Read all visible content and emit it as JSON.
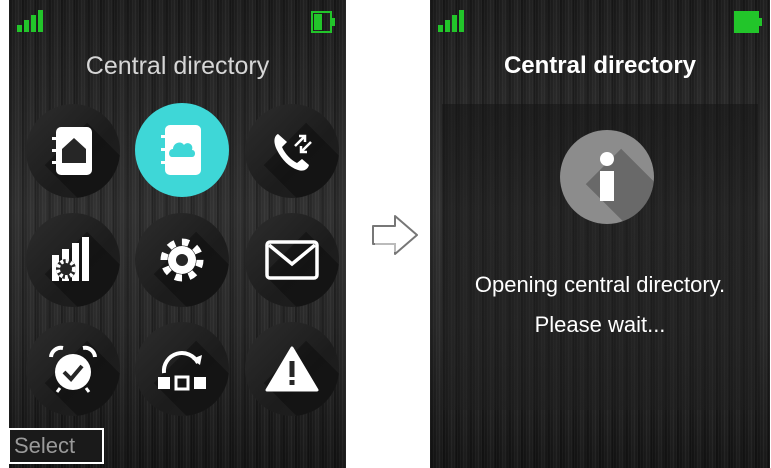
{
  "left_screen": {
    "status": {
      "signal_bars": 4,
      "battery_level": 0.5
    },
    "title": "Central directory",
    "menu_icons": [
      {
        "name": "local-phonebook-icon",
        "active": false
      },
      {
        "name": "central-directory-icon",
        "active": true
      },
      {
        "name": "call-list-icon",
        "active": false
      },
      {
        "name": "connections-settings-icon",
        "active": false
      },
      {
        "name": "settings-gear-icon",
        "active": false
      },
      {
        "name": "messaging-envelope-icon",
        "active": false
      },
      {
        "name": "alarm-clock-icon",
        "active": false
      },
      {
        "name": "shortcuts-icon",
        "active": false
      },
      {
        "name": "alarm-warning-icon",
        "active": false
      }
    ],
    "softkey_left": "Select"
  },
  "transition_arrow": "right-arrow-icon",
  "right_screen": {
    "status": {
      "signal_bars": 4,
      "battery_level": 1.0
    },
    "title": "Central directory",
    "message_line1": "Opening central directory.",
    "message_line2": "Please wait..."
  },
  "colors": {
    "accent_active": "#3ed7d7",
    "signal_green": "#22c52a",
    "battery_green": "#22c52a",
    "info_circle": "#8c8c8c"
  }
}
